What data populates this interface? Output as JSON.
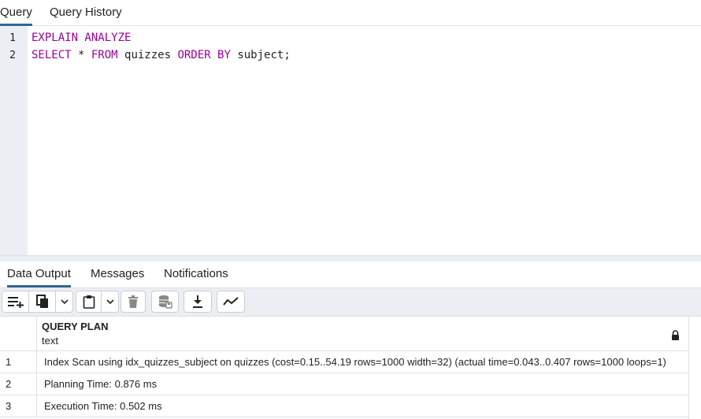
{
  "top_tabs": [
    {
      "label": "Query",
      "active": true
    },
    {
      "label": "Query History",
      "active": false
    }
  ],
  "editor": {
    "line_numbers": [
      "1",
      "2"
    ],
    "lines": [
      {
        "segments": [
          {
            "text": "EXPLAIN ANALYZE",
            "kw": true
          }
        ]
      },
      {
        "segments": [
          {
            "text": "SELECT",
            "kw": true
          },
          {
            "text": " * ",
            "kw": false
          },
          {
            "text": "FROM",
            "kw": true
          },
          {
            "text": " quizzes ",
            "kw": false
          },
          {
            "text": "ORDER BY",
            "kw": true
          },
          {
            "text": " subject;",
            "kw": false
          }
        ]
      }
    ]
  },
  "bottom_tabs": [
    {
      "label": "Data Output",
      "active": true
    },
    {
      "label": "Messages",
      "active": false
    },
    {
      "label": "Notifications",
      "active": false
    }
  ],
  "toolbar": {
    "icons": [
      "add-row-icon",
      "copy-icon",
      "chevron-down-icon",
      "paste-icon",
      "chevron-down-icon",
      "delete-icon",
      "save-data-icon",
      "download-icon",
      "graph-icon"
    ]
  },
  "grid": {
    "column": {
      "name": "QUERY PLAN",
      "type": "text"
    },
    "rows": [
      {
        "num": "1",
        "value": "Index Scan using idx_quizzes_subject on quizzes  (cost=0.15..54.19 rows=1000 width=32) (actual time=0.043..0.407 rows=1000 loops=1)"
      },
      {
        "num": "2",
        "value": "Planning Time: 0.876 ms"
      },
      {
        "num": "3",
        "value": "Execution Time: 0.502 ms"
      }
    ]
  },
  "colors": {
    "accent": "#326690",
    "keyword": "#990099",
    "panel_bg": "#ebeef3"
  }
}
